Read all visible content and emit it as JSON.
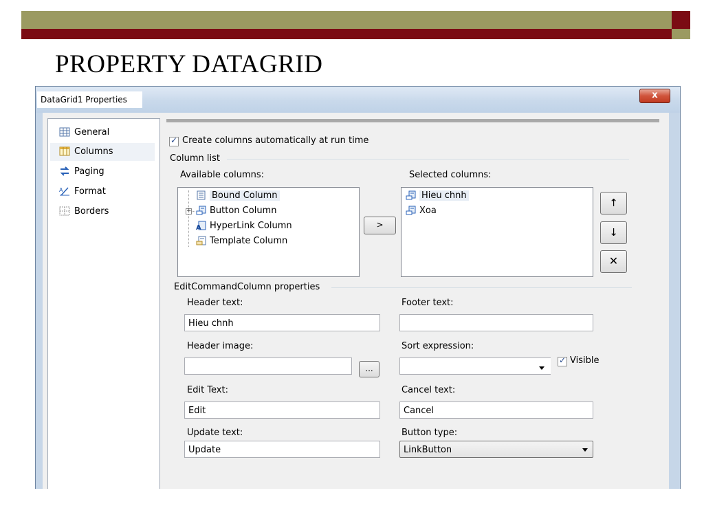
{
  "slide": {
    "title": "PROPERTY DATAGRID"
  },
  "dialog": {
    "title": "DataGrid1 Properties",
    "close_glyph": "x",
    "nav": [
      {
        "label": "General",
        "icon": "table-icon"
      },
      {
        "label": "Columns",
        "icon": "columns-icon",
        "selected": true
      },
      {
        "label": "Paging",
        "icon": "paging-icon"
      },
      {
        "label": "Format",
        "icon": "format-icon"
      },
      {
        "label": "Borders",
        "icon": "borders-icon"
      }
    ],
    "columns": {
      "auto_create_label": "Create columns automatically at run time",
      "auto_create_checked": true,
      "column_list_label": "Column list",
      "available_label": "Available columns:",
      "available": [
        {
          "label": "Bound Column",
          "icon": "bound-column-icon"
        },
        {
          "label": "Button Column",
          "icon": "button-column-icon"
        },
        {
          "label": "HyperLink Column",
          "icon": "hyperlink-column-icon"
        },
        {
          "label": "Template Column",
          "icon": "template-column-icon"
        }
      ],
      "add_button": ">",
      "selected_label": "Selected columns:",
      "selected": [
        {
          "label": "Hieu chnh",
          "icon": "button-column-icon"
        },
        {
          "label": "Xoa",
          "icon": "button-column-icon"
        }
      ],
      "move_up": "↑",
      "move_down": "↓",
      "delete": "✕"
    },
    "props": {
      "group_label": "EditCommandColumn properties",
      "header_text_label": "Header text:",
      "header_text_value": "Hieu chnh",
      "footer_text_label": "Footer text:",
      "footer_text_value": "",
      "header_image_label": "Header image:",
      "header_image_value": "",
      "browse_button": "...",
      "sort_expression_label": "Sort expression:",
      "sort_expression_value": "",
      "visible_label": "Visible",
      "visible_checked": true,
      "edit_text_label": "Edit Text:",
      "edit_text_value": "Edit",
      "cancel_text_label": "Cancel text:",
      "cancel_text_value": "Cancel",
      "update_text_label": "Update text:",
      "update_text_value": "Update",
      "button_type_label": "Button type:",
      "button_type_value": "LinkButton"
    }
  }
}
